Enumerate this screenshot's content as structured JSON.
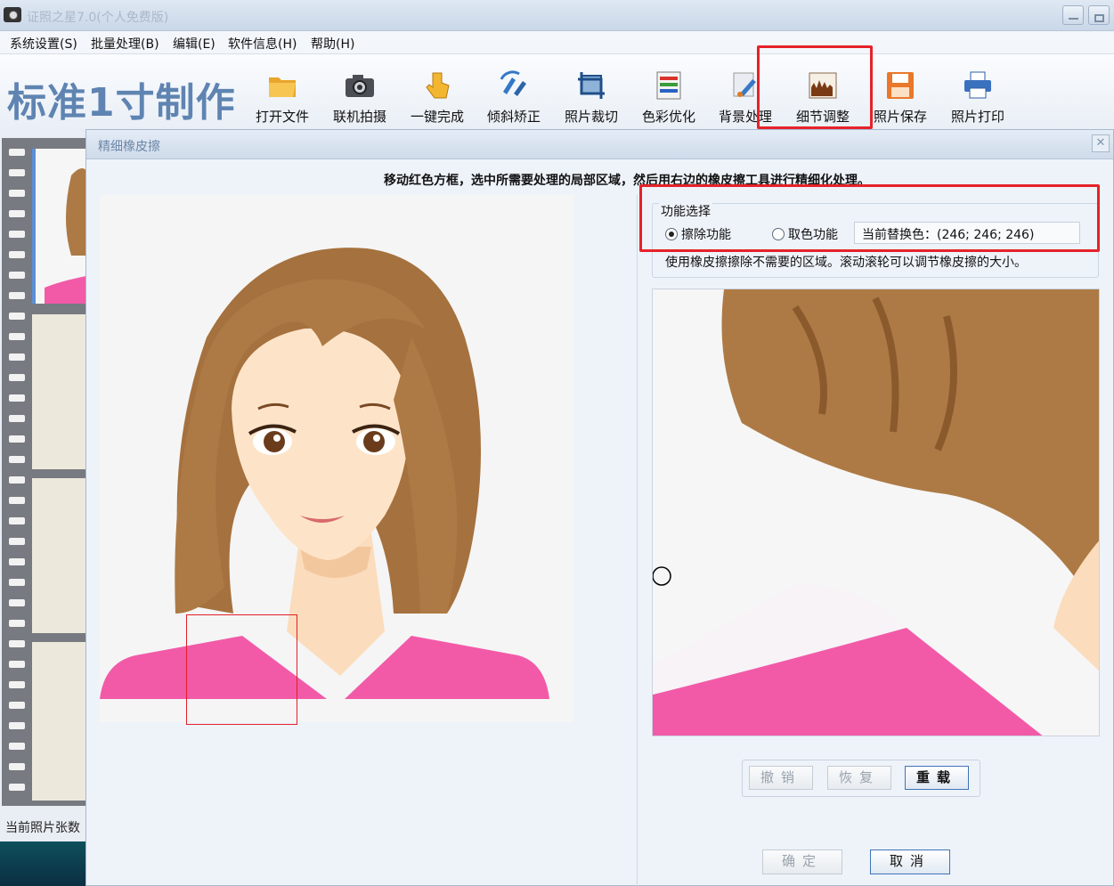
{
  "window": {
    "title": "证照之星7.0(个人免费版)"
  },
  "menu": [
    "系统设置(S)",
    "批量处理(B)",
    "编辑(E)",
    "软件信息(H)",
    "帮助(H)"
  ],
  "toolbar": {
    "brand": "标准1寸制作",
    "tools": [
      {
        "label": "打开文件",
        "icon": "folder-icon"
      },
      {
        "label": "联机拍摄",
        "icon": "camera-icon"
      },
      {
        "label": "一键完成",
        "icon": "hand-pointer-icon"
      },
      {
        "label": "倾斜矫正",
        "icon": "rotate-icon"
      },
      {
        "label": "照片裁切",
        "icon": "crop-icon"
      },
      {
        "label": "色彩优化",
        "icon": "color-bars-icon"
      },
      {
        "label": "背景处理",
        "icon": "brush-icon"
      },
      {
        "label": "细节调整",
        "icon": "detail-chart-icon"
      },
      {
        "label": "照片保存",
        "icon": "save-disk-icon"
      },
      {
        "label": "照片打印",
        "icon": "printer-icon"
      }
    ]
  },
  "sidebar": {
    "count_label": "当前照片张数"
  },
  "dialog": {
    "title": "精细橡皮擦",
    "instruction": "移动红色方框，选中所需要处理的局部区域，然后用右边的橡皮擦工具进行精细化处理。",
    "group_label": "功能选择",
    "radio_erase": "擦除功能",
    "radio_pick": "取色功能",
    "current_color": "当前替换色：(246; 246; 246)",
    "hint": "使用橡皮擦擦除不需要的区域。滚动滚轮可以调节橡皮擦的大小。",
    "buttons": {
      "undo": "撤销",
      "redo": "恢复",
      "reload": "重载",
      "ok": "确定",
      "cancel": "取消"
    }
  },
  "colors": {
    "hair": "#ad7a45",
    "skin": "#fbe3c8",
    "shirt": "#f25aa8",
    "highlight": "#e62229"
  }
}
